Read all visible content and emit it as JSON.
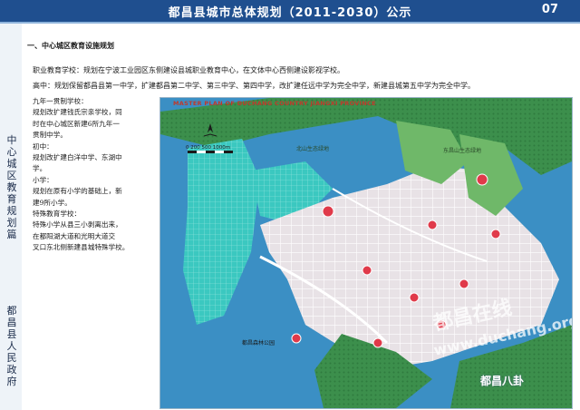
{
  "header": {
    "title": "都昌县城市总体规划（2011-2030）公示",
    "page_number": "07"
  },
  "side_labels": {
    "top": "中心城区教育规划篇",
    "bottom": "都昌县人民政府"
  },
  "section_title": "一、中心城区教育设施规划",
  "paragraphs": {
    "vocational": "职业教育学校：规划在宁波工业园区东侧建设县城职业教育中心，在文体中心西侧建设影视学校。",
    "high_school": "高中：规划保留都昌县第一中学，扩建都昌第二中学、第三中学、第四中学，改扩建任远中学为完全中学，新建县城第五中学为完全中学。"
  },
  "sidebar": {
    "lines": [
      "九年一贯制学校：",
      "规划改扩建钱氏宗亲学校，同",
      "时在中心城区新建6所九年一",
      "贯制中学。",
      "初中：",
      "规划改扩建白洋中学、东湖中",
      "学。",
      "小学：",
      "规划在原有小学的基础上，新",
      "建9所小学。",
      "特殊教育学校：",
      "特殊小学从县三小剥离出来，",
      "在都阳湖大道和光明大道交",
      "叉口东北侧新建县城特殊学校。"
    ]
  },
  "map": {
    "title": "MASTER PLAN OF DUCHANG COUNTRY JIANGXI PROVINCE",
    "scale_label": "0  200 500    1000m",
    "labels": {
      "north_park": "北山生态绿地",
      "east_park": "东昌山生态绿地",
      "south_label": "都昌森林公园"
    },
    "watermark_cn": "都昌在线",
    "watermark_url": "www.duchang.org"
  },
  "brand": "都昌八卦",
  "colors": {
    "header_bg": "#1f4f8f",
    "water": "#3b8fc4",
    "farmland": "#3bc8c0",
    "forest": "#3c8f4c",
    "urban": "#e6e0e3",
    "school_marker": "#e03a4a"
  }
}
